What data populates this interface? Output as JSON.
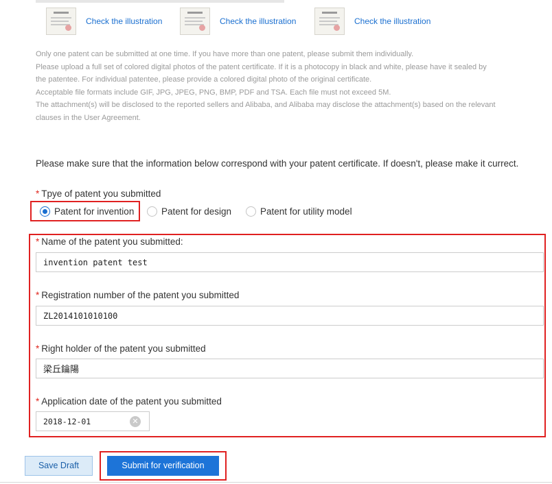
{
  "illustrations": [
    {
      "link": "Check the illustration"
    },
    {
      "link": "Check the illustration"
    },
    {
      "link": "Check the illustration"
    }
  ],
  "notes": [
    "Only one patent can be submitted at one time. If you have more than one patent, please submit them individually.",
    "Please upload a full set of colored digital photos of the patent certificate. If it is a photocopy in black and white, please have it sealed by",
    "the patentee. For individual patentee, please provide a colored digital photo of the original certificate.",
    "Acceptable file formats include GIF, JPG, JPEG, PNG, BMP, PDF and TSA. Each file must not exceed 5M.",
    "The attachment(s) will be disclosed to the reported sellers and Alibaba, and Alibaba may disclose the attachment(s) based on the relevant",
    "clauses in the User Agreement."
  ],
  "intro": "Please make sure that the information below correspond with your patent certificate. If doesn't, please make it currect.",
  "required_mark": "*",
  "patent_type": {
    "label": "Tpye of patent you submitted",
    "options": [
      {
        "label": "Patent for invention",
        "selected": true
      },
      {
        "label": "Patent for design",
        "selected": false
      },
      {
        "label": "Patent for utility model",
        "selected": false
      }
    ]
  },
  "fields": {
    "name": {
      "label": "Name of the patent you submitted:",
      "value": "invention patent test"
    },
    "registration": {
      "label": "Registration number of the patent you submitted",
      "value": "ZL2014101010100"
    },
    "holder": {
      "label": "Right holder of the patent you submitted",
      "value": "梁丘鑰陽"
    },
    "date": {
      "label": "Application date of the patent you submitted",
      "value": "2018-12-01"
    }
  },
  "buttons": {
    "save_draft": "Save Draft",
    "submit": "Submit for verification"
  },
  "colors": {
    "accent": "#1d74d8",
    "link": "#1a6fd0",
    "highlight_border": "#e02020",
    "required": "#e0271e"
  }
}
